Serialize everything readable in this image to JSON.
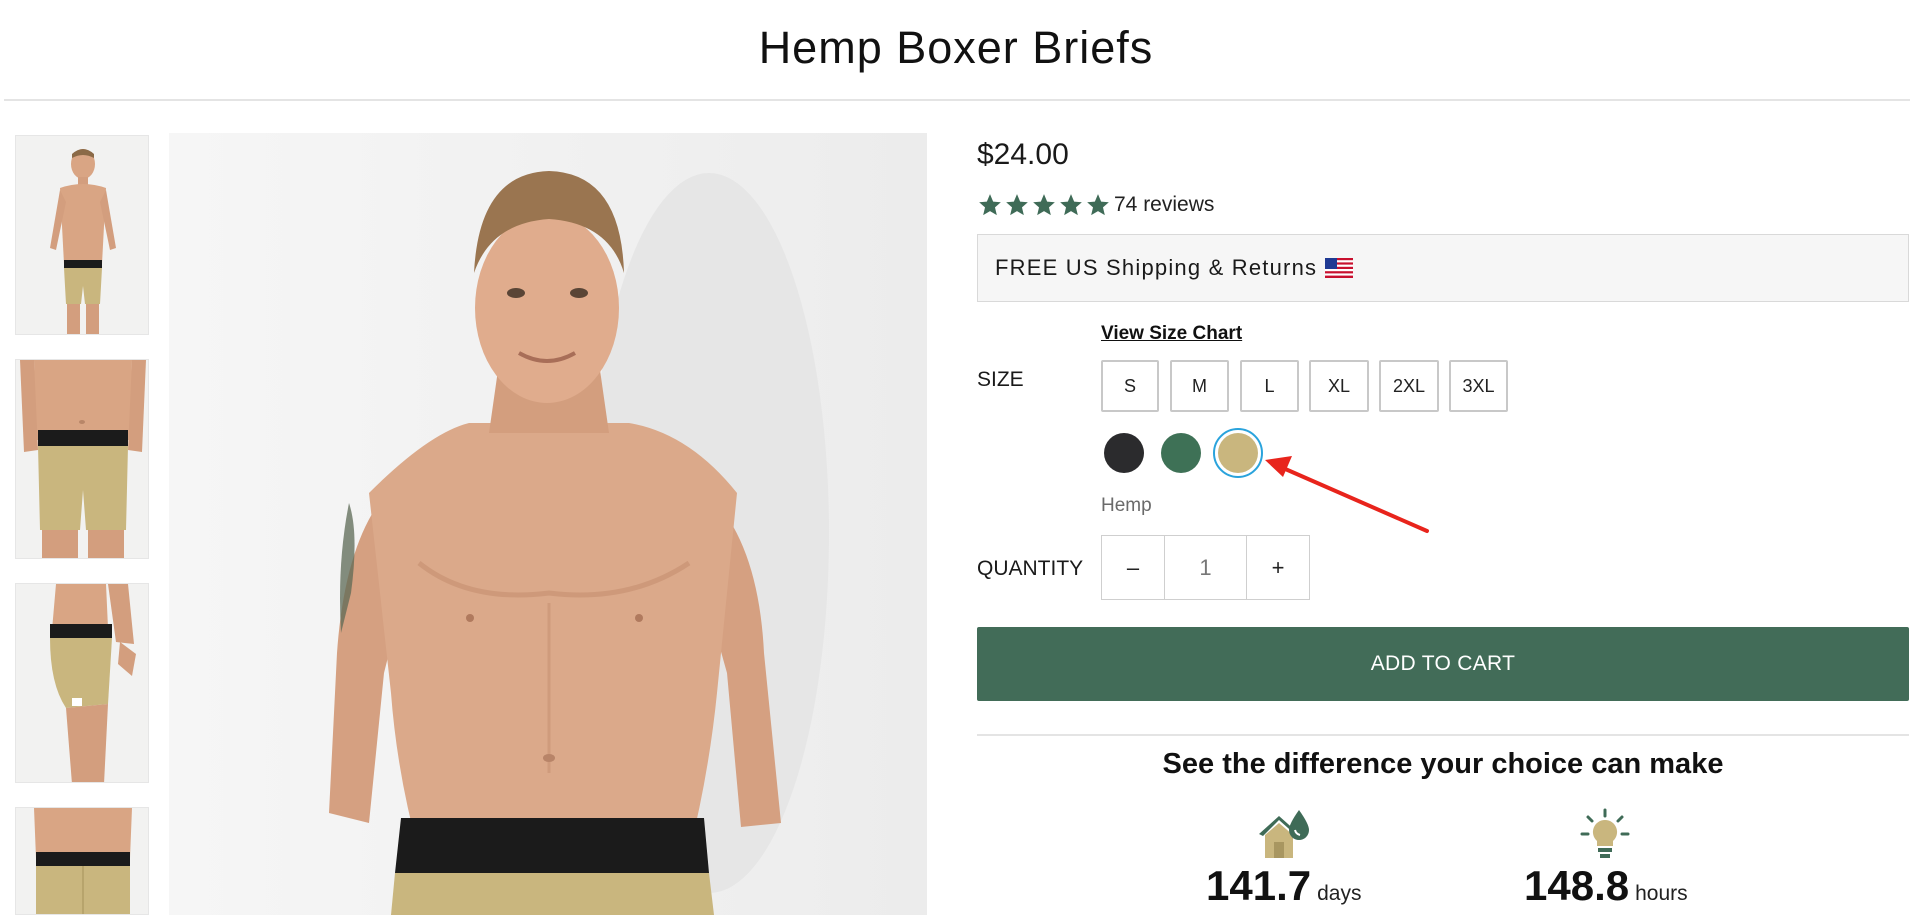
{
  "product": {
    "title": "Hemp Boxer Briefs",
    "price": "$24.00",
    "rating": {
      "stars": 5,
      "review_count": "74 reviews"
    },
    "shipping": "FREE US Shipping & Returns"
  },
  "options": {
    "size_chart_link": "View Size Chart",
    "size_label": "SIZE",
    "sizes": [
      "S",
      "M",
      "L",
      "XL",
      "2XL",
      "3XL"
    ],
    "colors": [
      {
        "name": "Black",
        "hex": "#2b2b2d"
      },
      {
        "name": "Green",
        "hex": "#3e7156"
      },
      {
        "name": "Hemp",
        "hex": "#c9b67e"
      }
    ],
    "selected_color_name": "Hemp",
    "quantity_label": "QUANTITY",
    "quantity": {
      "decrement": "–",
      "value": "1",
      "increment": "+"
    }
  },
  "cart": {
    "button_label": "ADD TO CART"
  },
  "impact": {
    "heading": "See the difference your choice can make",
    "stats": [
      {
        "icon": "house-water-icon",
        "value": "141.7",
        "unit": "days"
      },
      {
        "icon": "lightbulb-icon",
        "value": "148.8",
        "unit": "hours"
      }
    ]
  },
  "colors": {
    "accent_green": "#426c58",
    "star_color": "#3f6b57",
    "selected_ring": "#2aa3dc",
    "annotation_arrow": "#e8241c"
  }
}
